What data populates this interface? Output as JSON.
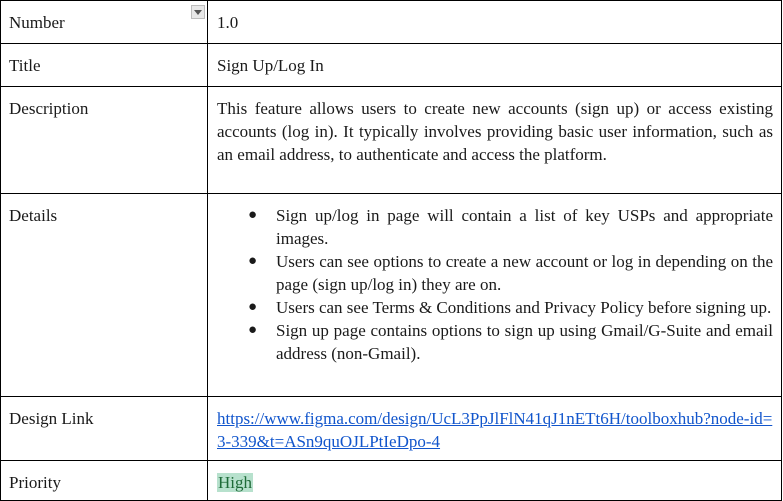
{
  "table": {
    "number": {
      "label": "Number",
      "value": "1.0"
    },
    "title": {
      "label": "Title",
      "value": "Sign Up/Log In"
    },
    "description": {
      "label": "Description",
      "value": "This feature allows users to create new accounts (sign up) or access existing accounts (log in). It typically involves providing basic user information, such as an email address, to authenticate and access the platform."
    },
    "details": {
      "label": "Details",
      "bullet": "●",
      "items": [
        "Sign up/log in page will contain a list of key USPs and appropriate images.",
        "Users can see options to create a new account or log in depending on the page (sign up/log in) they are on.",
        "Users can see Terms & Conditions and Privacy Policy before signing up.",
        "Sign up page contains options to sign up using Gmail/G-Suite and email address (non-Gmail)."
      ]
    },
    "design_link": {
      "label": "Design Link",
      "value": "https://www.figma.com/design/UcL3PpJlFlN41qJ1nETt6H/toolboxhub?node-id=3-339&t=ASn9quOJLPtIeDpo-4"
    },
    "priority": {
      "label": "Priority",
      "value": "High",
      "badge_bg": "#b7e1cd",
      "badge_color": "#1e6b38"
    }
  },
  "icons": {
    "dropdown": "dropdown-arrow-icon"
  },
  "colors": {
    "link": "#1155cc",
    "border": "#000000"
  }
}
